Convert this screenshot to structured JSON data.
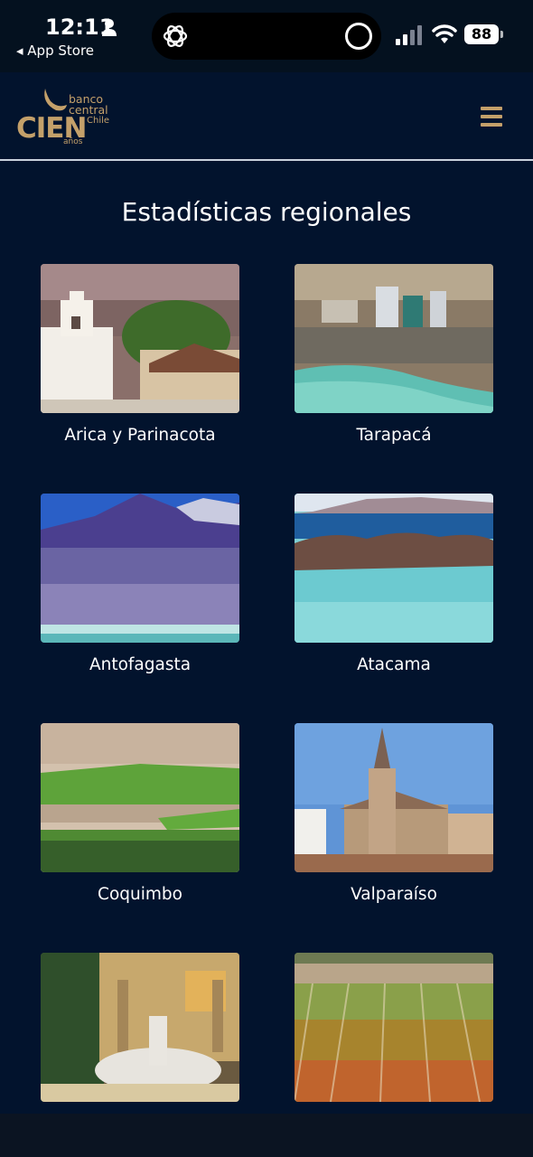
{
  "status_bar": {
    "time": "12:11",
    "back_label": "◂ App Store",
    "battery": "88"
  },
  "header": {
    "logo": {
      "line1": "banco",
      "line2": "central",
      "chile": "Chile",
      "cien": "CIEN",
      "anos": "años"
    }
  },
  "page": {
    "title": "Estadísticas regionales"
  },
  "regions": [
    {
      "label": "Arica y Parinacota"
    },
    {
      "label": "Tarapacá"
    },
    {
      "label": "Antofagasta"
    },
    {
      "label": "Atacama"
    },
    {
      "label": "Coquimbo"
    },
    {
      "label": "Valparaíso"
    },
    {
      "label": ""
    },
    {
      "label": ""
    }
  ],
  "colors": {
    "background": "#02132d",
    "accent_gold": "#c4a06a"
  }
}
